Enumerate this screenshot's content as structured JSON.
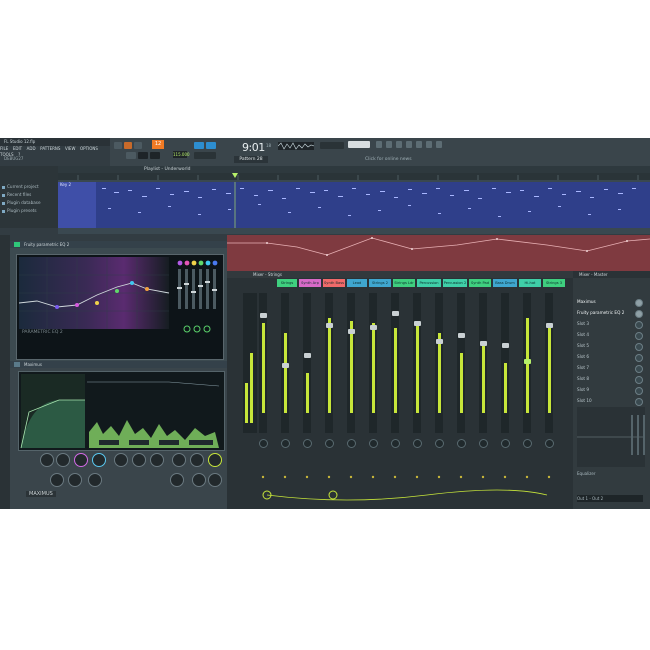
{
  "app": {
    "title": "FL Studio 12.flp",
    "menu": [
      "FILE",
      "EDIT",
      "ADD",
      "PATTERNS",
      "VIEW",
      "OPTIONS",
      "TOOLS",
      "?"
    ],
    "hint": "DEBUG27"
  },
  "toolbar": {
    "bpm_digit": "12",
    "tempo": "115.000",
    "time": "9:01",
    "time_ms": "18",
    "pattern": "Pattern 28",
    "news": "Click for online news"
  },
  "browser": {
    "items": [
      "Current project",
      "Recent files",
      "Plugin database",
      "Plugin presets"
    ]
  },
  "playlist": {
    "title": "Playlist - Underworld",
    "track_label": "Key 2"
  },
  "eq": {
    "title": "Fruity parametric EQ 2",
    "logo": "PARAMETRIC EQ 2"
  },
  "maximus": {
    "title": "Maximus",
    "logo": "MAXIMUS"
  },
  "mixer": {
    "title": "Mixer - Strings",
    "channels": [
      "Strings",
      "Synth Arp",
      "Synth Bass",
      "Lead",
      "Strings 2",
      "Strings Ldr",
      "Percussion",
      "Percussion 2",
      "Synth Pad",
      "Bass Drum",
      "Hi-hat",
      "Strings 3"
    ]
  },
  "insert": {
    "title": "Mixer - Master",
    "slots": [
      "Maximus",
      "Fruity parametric EQ 2",
      "Slot 3",
      "Slot 4",
      "Slot 5",
      "Slot 6",
      "Slot 7",
      "Slot 8",
      "Slot 9",
      "Slot 10"
    ],
    "bottom_label": "Equalizer",
    "output": "Out 1 - Out 2"
  },
  "colors": {
    "accent_orange": "#f07a24",
    "meter_green": "#c7e63a",
    "playlist_blue": "#2f3f8a",
    "automation_red": "#7f3a40",
    "mixer_label_green": "#3fcf7f",
    "mixer_label_blue": "#3fa6cf"
  }
}
